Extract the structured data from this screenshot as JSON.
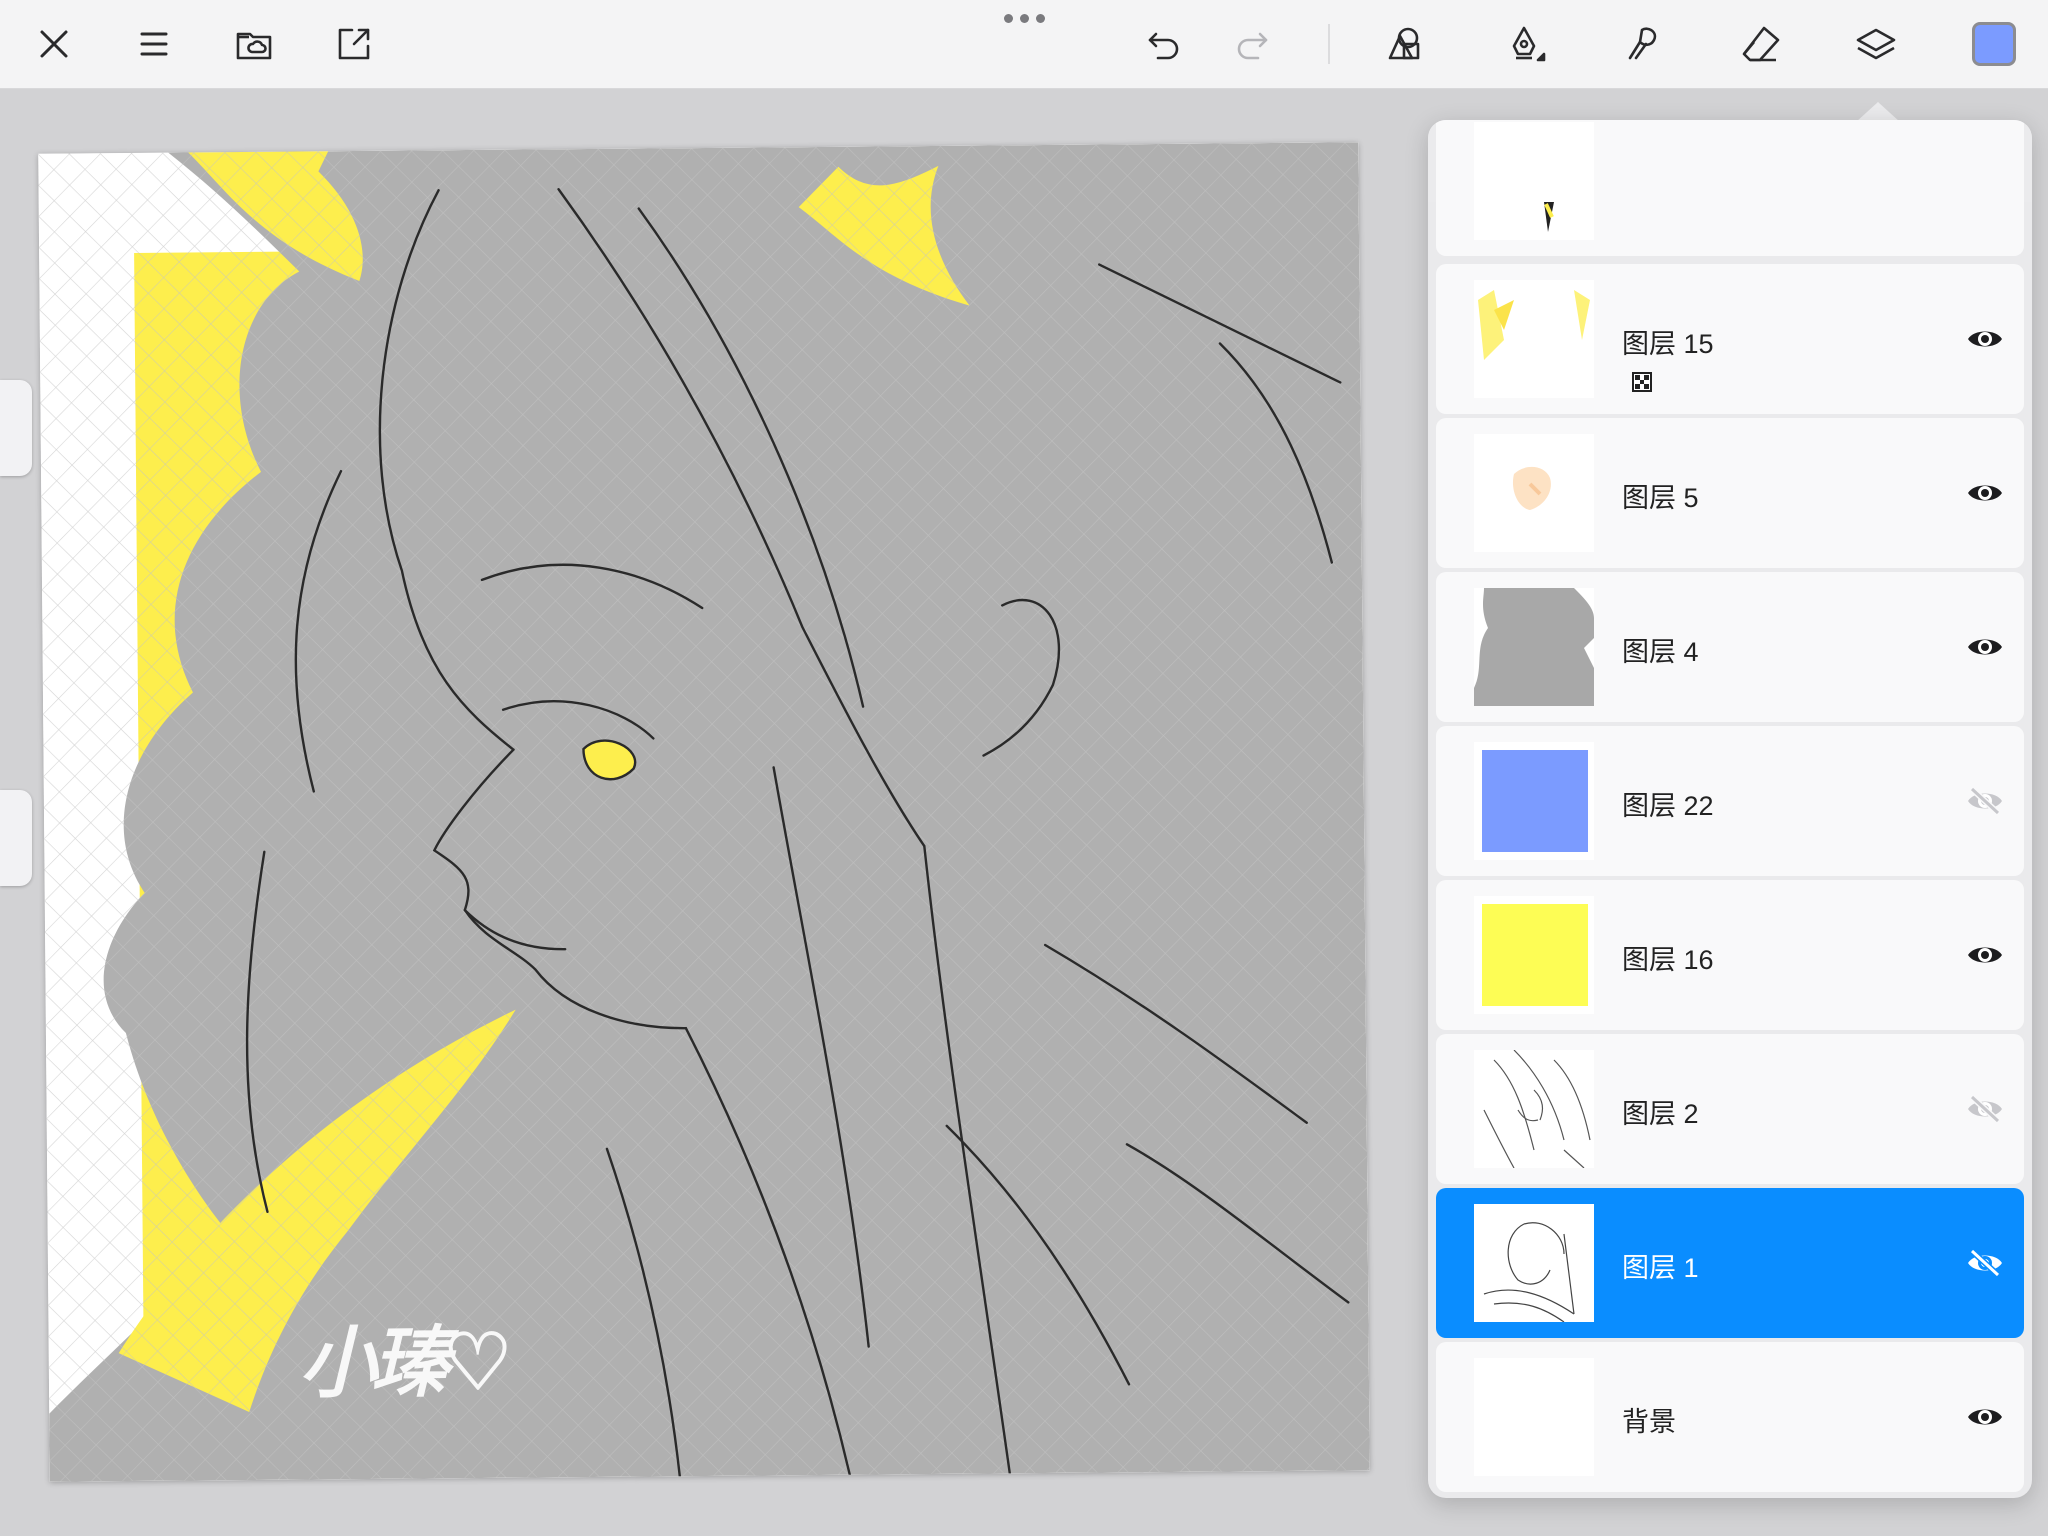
{
  "toolbar": {
    "close_icon": "close-icon",
    "menu_icon": "menu-icon",
    "gallery_icon": "folder-cloud-icon",
    "share_icon": "export-icon",
    "undo_icon": "undo-icon",
    "redo_icon": "redo-icon",
    "shapes_icon": "shapes-icon",
    "brush_icon": "pen-nib-icon",
    "smudge_icon": "smudge-icon",
    "eraser_icon": "eraser-icon",
    "layers_icon": "layers-icon",
    "current_color": "#7b9bff"
  },
  "layers_panel": {
    "add_icon": "plus-icon",
    "settings_icon": "target-icon",
    "layers": [
      {
        "name": "图层 15",
        "visible": true,
        "alpha_locked": true,
        "thumb": "yellow-strokes"
      },
      {
        "name": "图层 5",
        "visible": true,
        "alpha_locked": false,
        "thumb": "skin-tone"
      },
      {
        "name": "图层 4",
        "visible": true,
        "alpha_locked": false,
        "thumb": "gray-silhouette"
      },
      {
        "name": "图层 22",
        "visible": false,
        "alpha_locked": false,
        "thumb": "blue-fill",
        "color": "#7b9bff"
      },
      {
        "name": "图层 16",
        "visible": true,
        "alpha_locked": false,
        "thumb": "yellow-fill",
        "color": "#fdfd55"
      },
      {
        "name": "图层 2",
        "visible": false,
        "alpha_locked": false,
        "thumb": "sketch"
      },
      {
        "name": "图层 1",
        "visible": false,
        "alpha_locked": false,
        "thumb": "rough-sketch",
        "selected": true
      },
      {
        "name": "背景",
        "visible": true,
        "alpha_locked": false,
        "thumb": "white"
      }
    ]
  },
  "canvas": {
    "signature": "小瑧♡",
    "palette": {
      "yellow": "#fdee4d",
      "gray": "#b0b0b0",
      "line": "#2a2a2a"
    }
  }
}
